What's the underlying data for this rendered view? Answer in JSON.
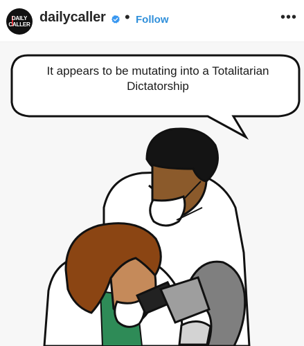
{
  "header": {
    "avatar_text": [
      "DAILY",
      "CALLER"
    ],
    "username": "dailycaller",
    "separator": "•",
    "follow_label": "Follow",
    "more_label": "•••",
    "verified_color": "#3897f0",
    "follow_color": "#2f8fda"
  },
  "post": {
    "speech_text_line1": "It appears to be mutating into a Totalitarian",
    "speech_text_line2": "Dictatorship"
  }
}
